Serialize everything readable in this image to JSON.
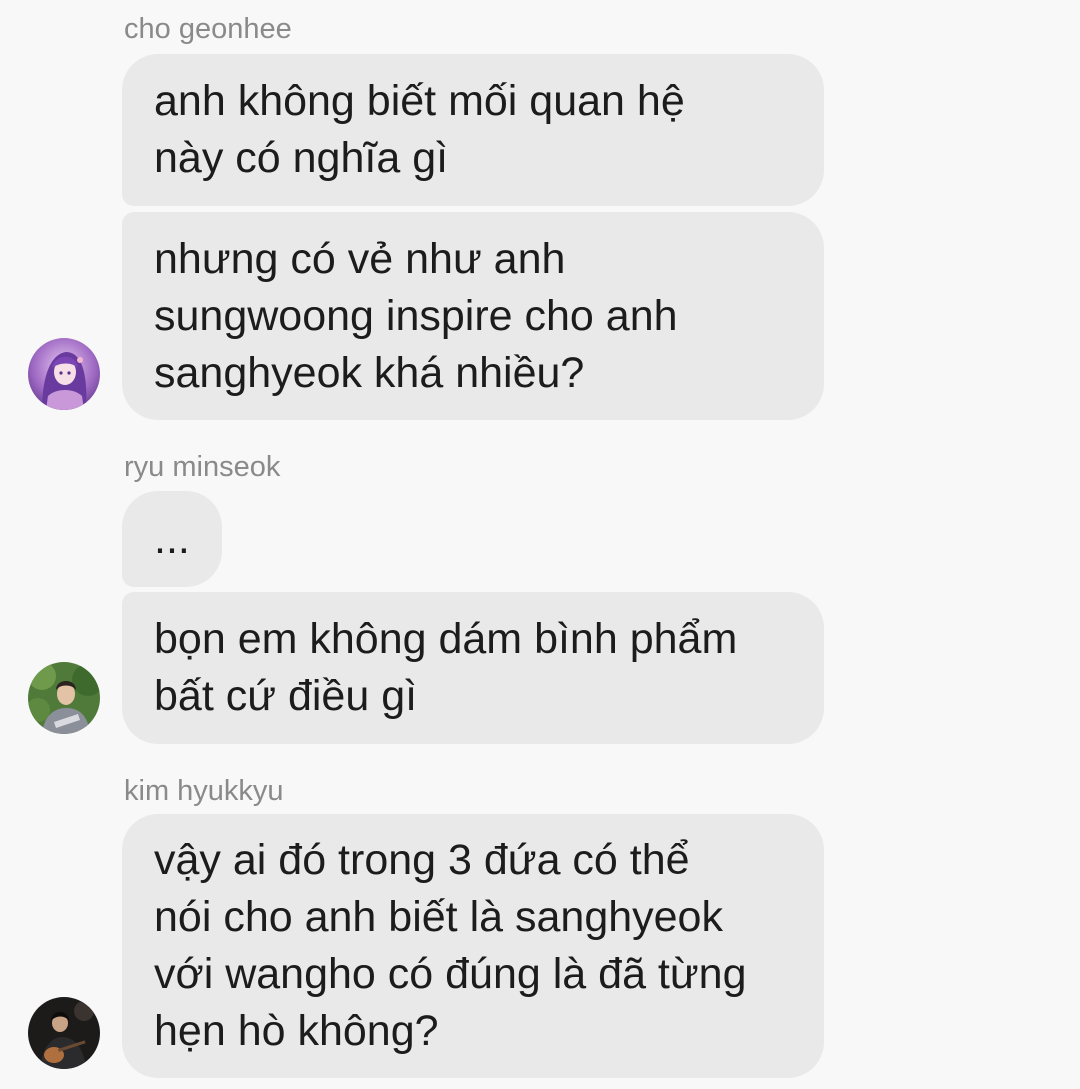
{
  "messages": [
    {
      "sender": "cho geonhee",
      "avatar_icon": "anime-girl-avatar-icon",
      "bubbles": [
        [
          "anh không biết mối quan hệ",
          "này có nghĩa gì"
        ],
        [
          "nhưng có vẻ như anh",
          "sungwoong inspire cho anh",
          "sanghyeok khá nhiều?"
        ]
      ]
    },
    {
      "sender": "ryu minseok",
      "avatar_icon": "person-photo-avatar-icon",
      "bubbles": [
        [
          "..."
        ],
        [
          "bọn em không dám bình phẩm",
          "bất cứ điều gì"
        ]
      ]
    },
    {
      "sender": "kim hyukkyu",
      "avatar_icon": "person-guitar-avatar-icon",
      "bubbles": [
        [
          "vậy ai đó trong 3 đứa có thể",
          "nói cho anh biết là sanghyeok",
          "với wangho có đúng là đã từng",
          "hẹn hò không?"
        ]
      ]
    }
  ],
  "colors": {
    "background": "#f8f8f8",
    "bubble": "#e9e9e9",
    "text": "#1c1c1c",
    "sender_name": "#8a8a8a"
  }
}
